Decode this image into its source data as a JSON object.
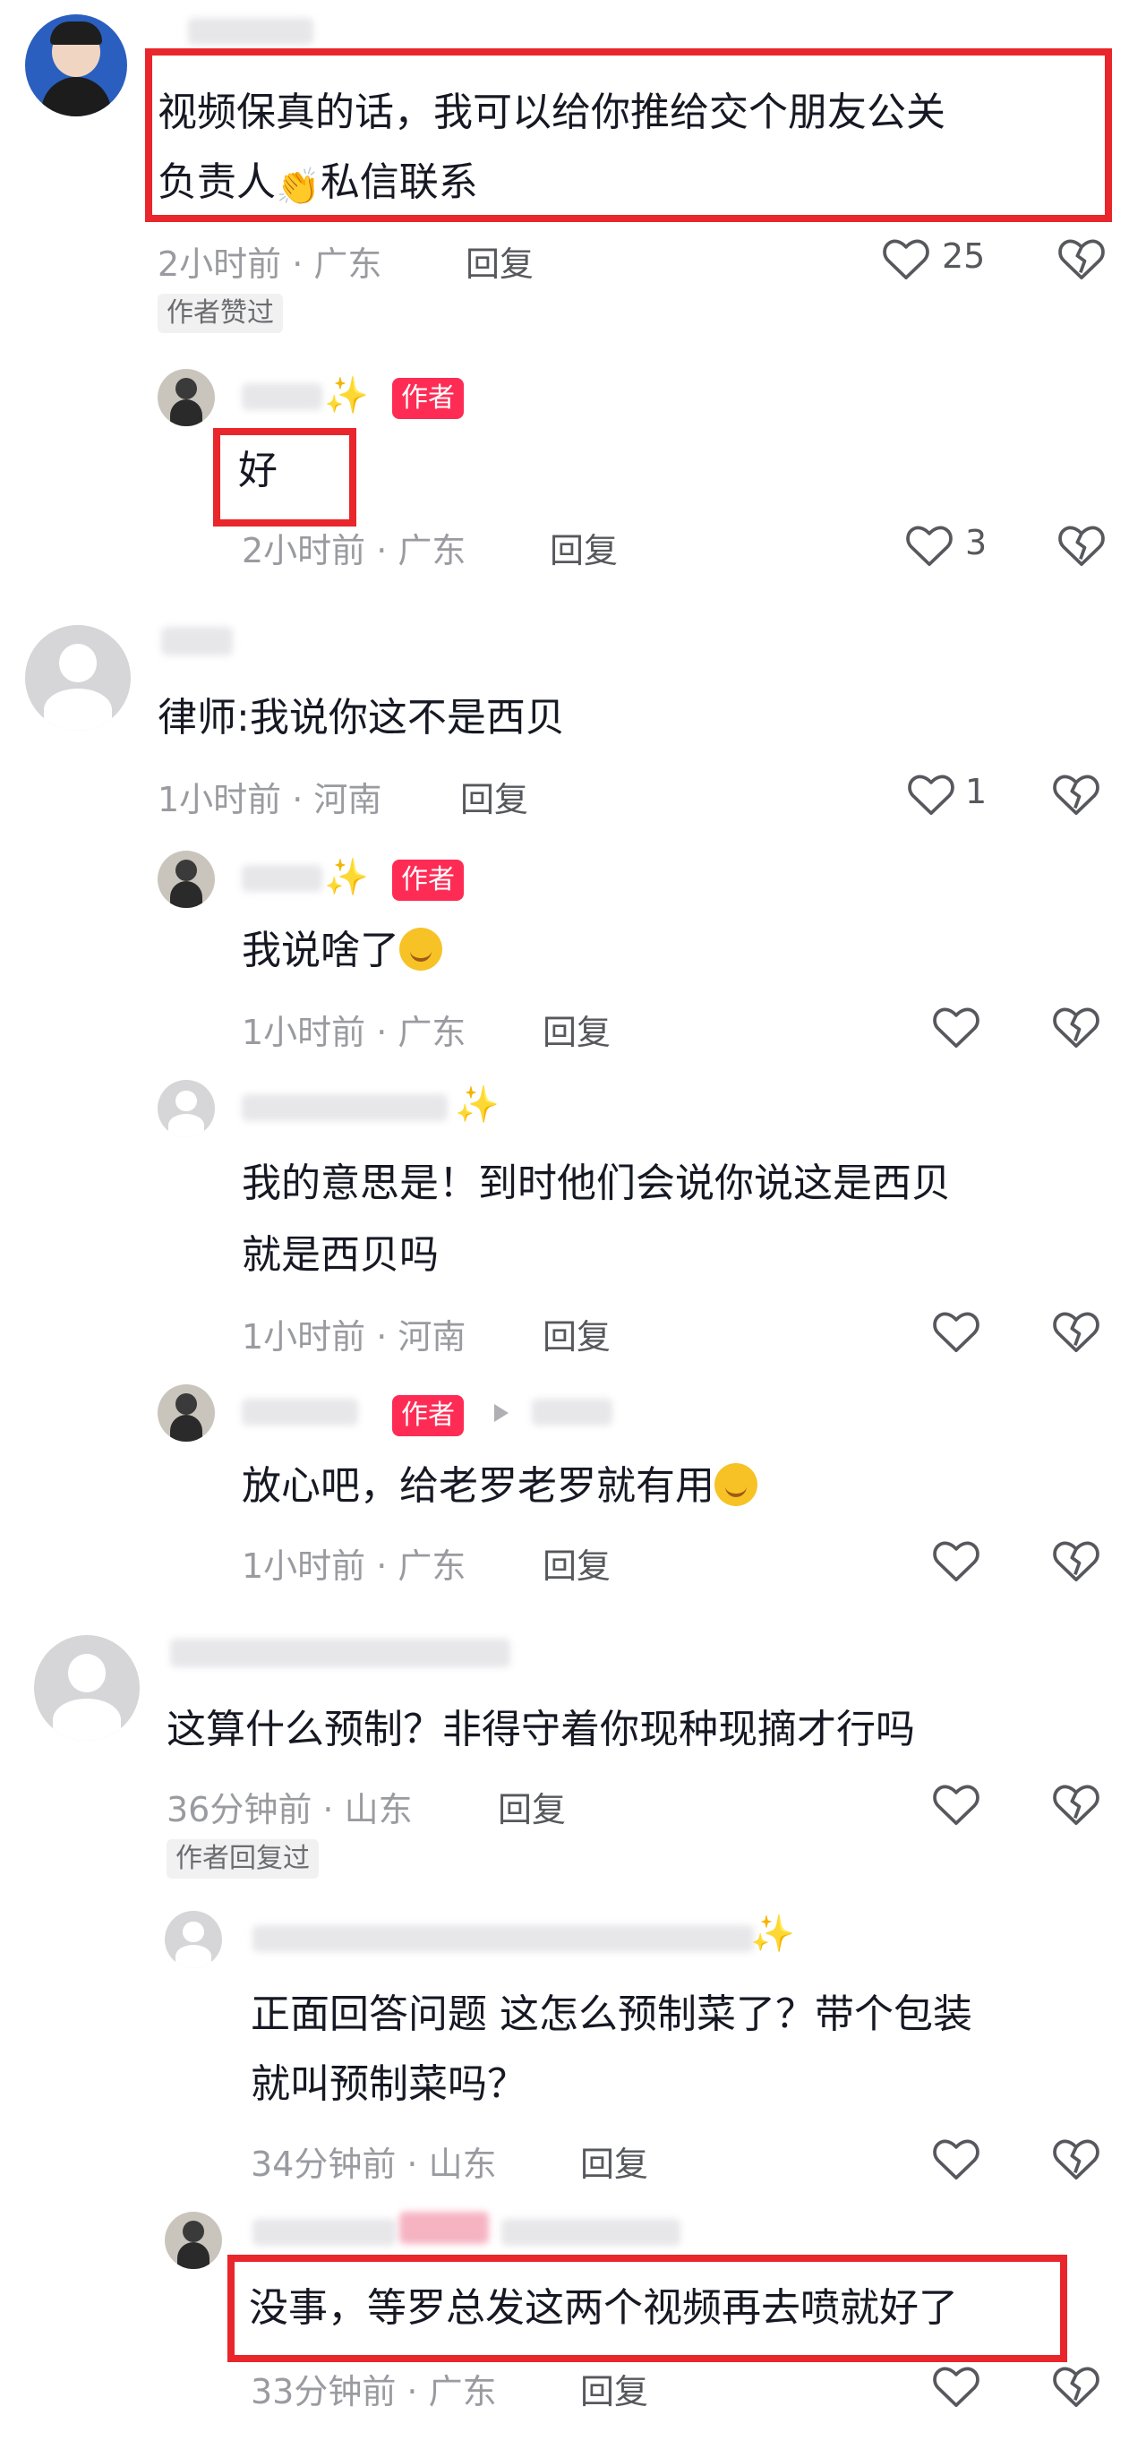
{
  "comments": [
    {
      "text_line1": "视频保真的话，我可以给你推给交个朋友公关",
      "text_line2_pre": "负责人",
      "text_line2_post": "私信联系",
      "meta": "2小时前 · 广东",
      "reply": "回复",
      "likes": "25",
      "tag": "作者赞过",
      "reply_item": {
        "badge": "作者",
        "text": "好",
        "meta": "2小时前 · 广东",
        "reply": "回复",
        "likes": "3"
      }
    },
    {
      "text": "律师:我说你这不是西贝",
      "meta": "1小时前 · 河南",
      "reply": "回复",
      "likes": "1",
      "replies": [
        {
          "badge": "作者",
          "text": "我说啥了",
          "meta": "1小时前 · 广东",
          "reply": "回复"
        },
        {
          "text_line1": "我的意思是！到时他们会说你说这是西贝",
          "text_line2": "就是西贝吗",
          "meta": "1小时前 · 河南",
          "reply": "回复"
        },
        {
          "badge": "作者",
          "text": "放心吧，给老罗老罗就有用",
          "meta": "1小时前 · 广东",
          "reply": "回复"
        }
      ]
    },
    {
      "text": "这算什么预制？非得守着你现种现摘才行吗",
      "meta": "36分钟前 · 山东",
      "reply": "回复",
      "tag": "作者回复过",
      "replies": [
        {
          "text_line1": "正面回答问题 这怎么预制菜了？带个包装",
          "text_line2": "就叫预制菜吗？",
          "meta": "34分钟前 · 山东",
          "reply": "回复"
        },
        {
          "text": "没事，等罗总发这两个视频再去喷就好了",
          "meta": "33分钟前 · 广东",
          "reply": "回复"
        }
      ]
    }
  ],
  "colors": {
    "accent": "#fe2c55",
    "highlight": "#e8262b",
    "meta": "#9a9ba0"
  },
  "icons": [
    "heart-icon",
    "broken-heart-icon",
    "clap-emoji",
    "smirk-emoji",
    "sparkle-emoji"
  ]
}
